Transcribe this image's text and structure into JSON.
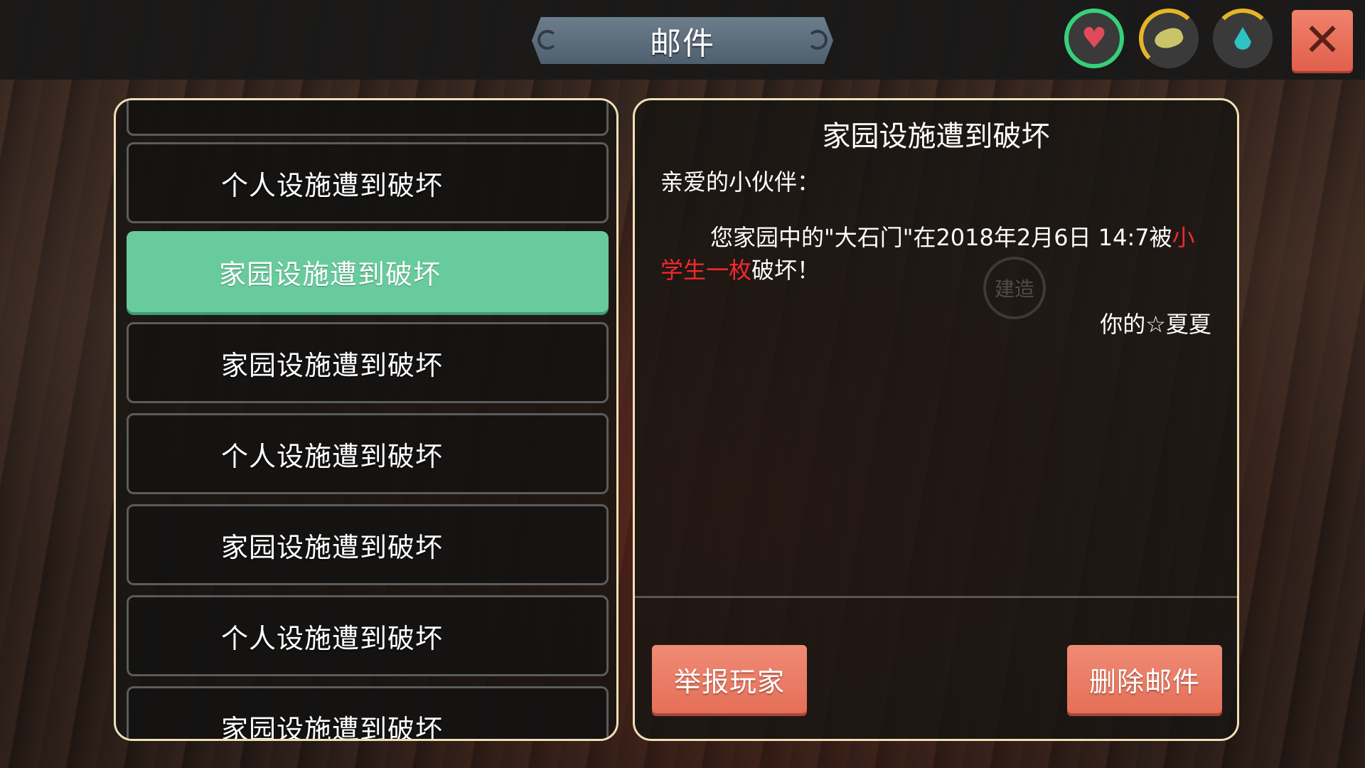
{
  "window": {
    "title": "邮件"
  },
  "stats": {
    "health_icon": "heart-icon",
    "hunger_icon": "food-icon",
    "thirst_icon": "water-drop-icon",
    "health_color": "#36d07a",
    "gauge_color": "#e6b526"
  },
  "close": {
    "glyph": "✕"
  },
  "mail_list": {
    "items": [
      {
        "label": ""
      },
      {
        "label": "个人设施遭到破坏"
      },
      {
        "label": "家园设施遭到破坏"
      },
      {
        "label": "家园设施遭到破坏"
      },
      {
        "label": "个人设施遭到破坏"
      },
      {
        "label": "家园设施遭到破坏"
      },
      {
        "label": "个人设施遭到破坏"
      },
      {
        "label": "家园设施遭到破坏"
      }
    ],
    "selected_index": 2,
    "selected_color": "#68cb9d"
  },
  "detail": {
    "title": "家园设施遭到破坏",
    "greeting": "亲爱的小伙伴：",
    "body_before": "您家园中的\"大石门\"在2018年2月6日 14:7被",
    "body_player": "小学生一枚",
    "body_after": "破坏！",
    "signature": "你的☆夏夏",
    "watermark": "建造",
    "highlight_color": "#f02a2a"
  },
  "actions": {
    "report_label": "举报玩家",
    "delete_label": "删除邮件",
    "button_color": "#e56f58"
  }
}
